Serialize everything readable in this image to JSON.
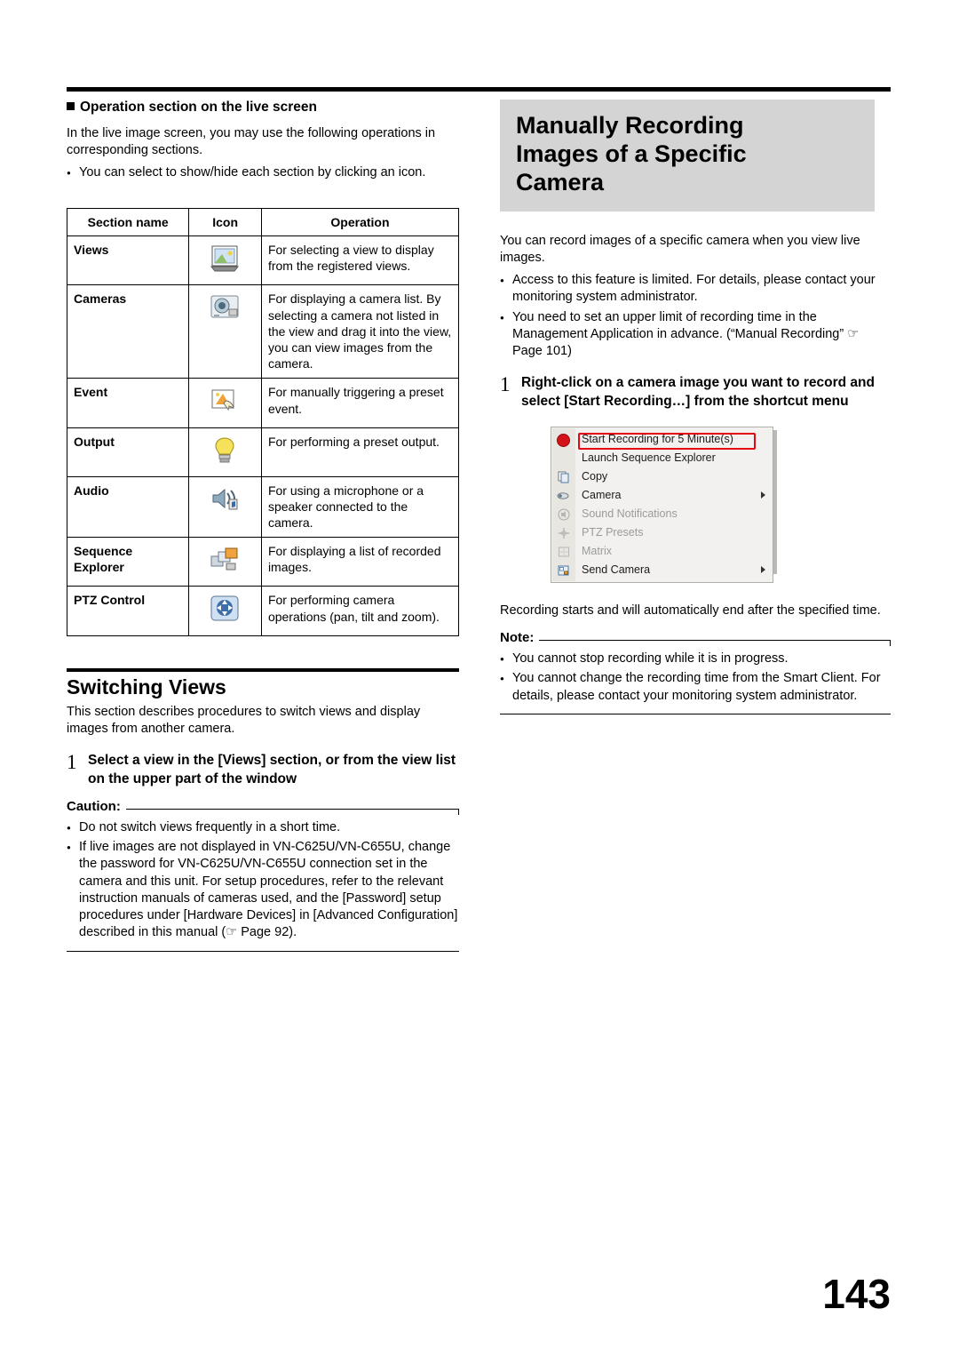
{
  "page_number": "143",
  "left": {
    "section_heading": "Operation section on the live screen",
    "intro": "In the live image screen, you may use the following operations in corresponding sections.",
    "bullets": [
      "You can select to show/hide each section by clicking an icon."
    ],
    "table": {
      "headers": [
        "Section name",
        "Icon",
        "Operation"
      ],
      "rows": [
        {
          "name": "Views",
          "icon": "views-icon",
          "operation": "For selecting a view to display from the registered views."
        },
        {
          "name": "Cameras",
          "icon": "cameras-icon",
          "operation": "For displaying a camera list. By selecting a camera not listed in the view and drag it into the view, you can view images from the camera."
        },
        {
          "name": "Event",
          "icon": "event-icon",
          "operation": "For manually triggering a preset event."
        },
        {
          "name": "Output",
          "icon": "output-lightbulb-icon",
          "operation": "For performing a preset output."
        },
        {
          "name": "Audio",
          "icon": "audio-speaker-icon",
          "operation": "For using a microphone or a speaker connected to the camera."
        },
        {
          "name": "Sequence Explorer",
          "icon": "sequence-explorer-icon",
          "operation": "For displaying a list of recorded images."
        },
        {
          "name": "PTZ Control",
          "icon": "ptz-control-icon",
          "operation": "For performing camera operations (pan, tilt and zoom)."
        }
      ]
    },
    "switching_views": {
      "title": "Switching Views",
      "intro": "This section describes procedures to switch views and display images from another camera.",
      "step_number": "1",
      "step_text": "Select a view in the [Views] section, or from the view list on the upper part of the window",
      "caution_label": "Caution:",
      "caution_bullets": [
        "Do not switch views frequently in a short time.",
        "If live images are not displayed in VN-C625U/VN-C655U, change the password for VN-C625U/VN-C655U connection set in the camera and this unit. For setup procedures, refer to the relevant instruction manuals of cameras used, and the [Password] setup procedures under [Hardware Devices] in [Advanced Configuration] described in this manual (☞ Page 92)."
      ]
    }
  },
  "right": {
    "chapter_title_lines": [
      "Manually Recording",
      "Images of a Specific",
      "Camera"
    ],
    "intro": "You can record images of a specific camera when you view live images.",
    "bullets": [
      "Access to this feature is limited. For details, please contact your monitoring system administrator.",
      "You need to set an upper limit of recording time in the Management Application in advance. (“Manual Recording” ☞ Page 101)"
    ],
    "step_number": "1",
    "step_text": "Right-click on a camera image you want to record and select [Start Recording…] from the shortcut menu",
    "context_menu": {
      "items": [
        {
          "label": "Start Recording for 5 Minute(s)",
          "icon": "record-red-dot-icon",
          "dim": false,
          "submenu": false,
          "highlighted": true
        },
        {
          "label": "Launch Sequence Explorer",
          "icon": "none",
          "dim": false,
          "submenu": false,
          "highlighted": false
        },
        {
          "label": "Copy",
          "icon": "copy-icon",
          "dim": false,
          "submenu": false,
          "highlighted": false
        },
        {
          "label": "Camera",
          "icon": "camera-icon",
          "dim": false,
          "submenu": true,
          "highlighted": false
        },
        {
          "label": "Sound Notifications",
          "icon": "sound-icon",
          "dim": true,
          "submenu": false,
          "highlighted": false
        },
        {
          "label": "PTZ Presets",
          "icon": "ptz-icon",
          "dim": true,
          "submenu": false,
          "highlighted": false
        },
        {
          "label": "Matrix",
          "icon": "matrix-icon",
          "dim": true,
          "submenu": false,
          "highlighted": false
        },
        {
          "label": "Send Camera",
          "icon": "send-camera-icon",
          "dim": false,
          "submenu": true,
          "highlighted": false
        }
      ],
      "highlight_color": "#e30613"
    },
    "after_menu_text": "Recording starts and will automatically end after the specified time.",
    "note_label": "Note:",
    "note_bullets": [
      "You cannot stop recording while it is in progress.",
      "You cannot change the recording time from the Smart Client. For details, please contact your monitoring system administrator."
    ]
  }
}
